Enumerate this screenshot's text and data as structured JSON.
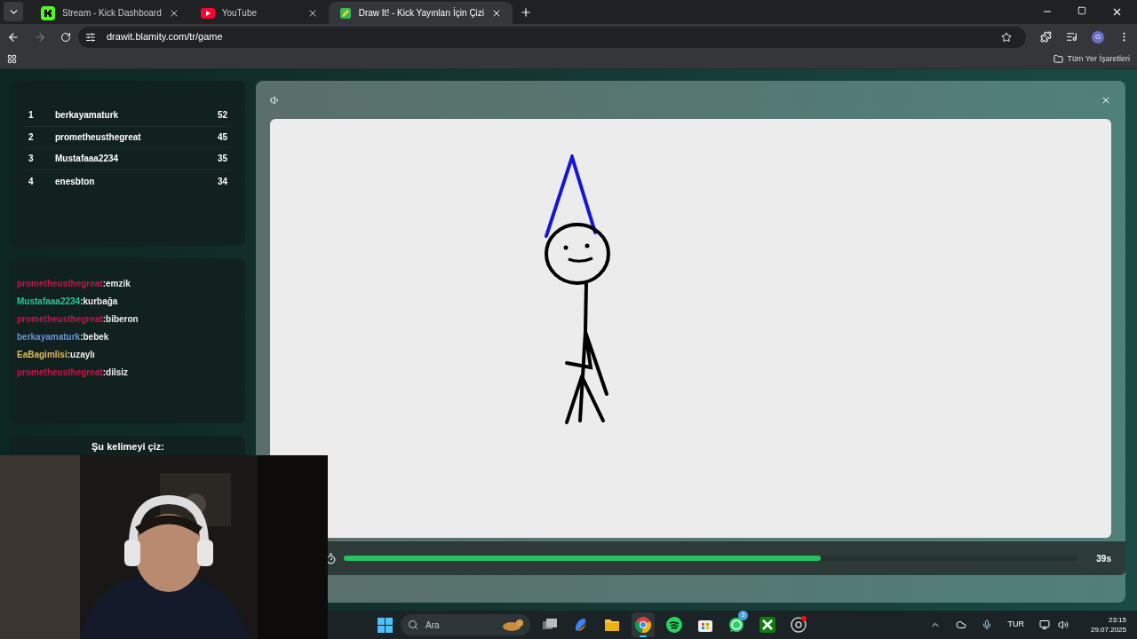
{
  "browser": {
    "tabs": [
      {
        "title": "Stream - Kick Dashboard",
        "kind": "kick",
        "selected": false
      },
      {
        "title": "YouTube",
        "kind": "youtube",
        "selected": false
      },
      {
        "title": "Draw It! - Kick Yayınları İçin Çizi",
        "kind": "drawit",
        "selected": true
      }
    ],
    "url": "drawit.blamity.com/tr/game",
    "profile": "G",
    "bookmarks_label": "Tüm Yer İşaretleri"
  },
  "leaderboard": [
    {
      "rank": "1",
      "name": "berkayamaturk",
      "score": "52"
    },
    {
      "rank": "2",
      "name": "prometheusthegreat",
      "score": "45"
    },
    {
      "rank": "3",
      "name": "Mustafaaa2234",
      "score": "35"
    },
    {
      "rank": "4",
      "name": "enesbton",
      "score": "34"
    }
  ],
  "chat": [
    {
      "user": "prometheusthegreat",
      "color": "#c2164a",
      "text": ":emzik"
    },
    {
      "user": "Mustafaaa2234",
      "color": "#22c79a",
      "text": ":kurbağa"
    },
    {
      "user": "prometheusthegreat",
      "color": "#c2164a",
      "text": ":biberon"
    },
    {
      "user": "berkayamaturk",
      "color": "#6b93d6",
      "text": ":bebek"
    },
    {
      "user": "EaBagimlisi",
      "color": "#e0b860",
      "text": ":uzaylı"
    },
    {
      "user": "prometheusthegreat",
      "color": "#c2164a",
      "text": ":dilsiz"
    }
  ],
  "word_prompt": "Şu kelimeyi çiz:",
  "timer": {
    "level": 0.65,
    "reading": "39s"
  },
  "taskbar": {
    "search_placeholder": "Ara",
    "apps": [
      {
        "kind": "taskview",
        "selected": false
      },
      {
        "kind": "copilot",
        "selected": false
      },
      {
        "kind": "folder",
        "selected": false
      },
      {
        "kind": "chrome",
        "selected": true
      },
      {
        "kind": "spotify",
        "selected": false
      },
      {
        "kind": "store",
        "selected": false
      },
      {
        "kind": "whatsapp",
        "selected": false,
        "badge": "3"
      },
      {
        "kind": "xbox",
        "selected": false
      },
      {
        "kind": "obs",
        "selected": false
      }
    ],
    "language": "TUR",
    "time": "23:15",
    "date": "29.07.2025"
  }
}
